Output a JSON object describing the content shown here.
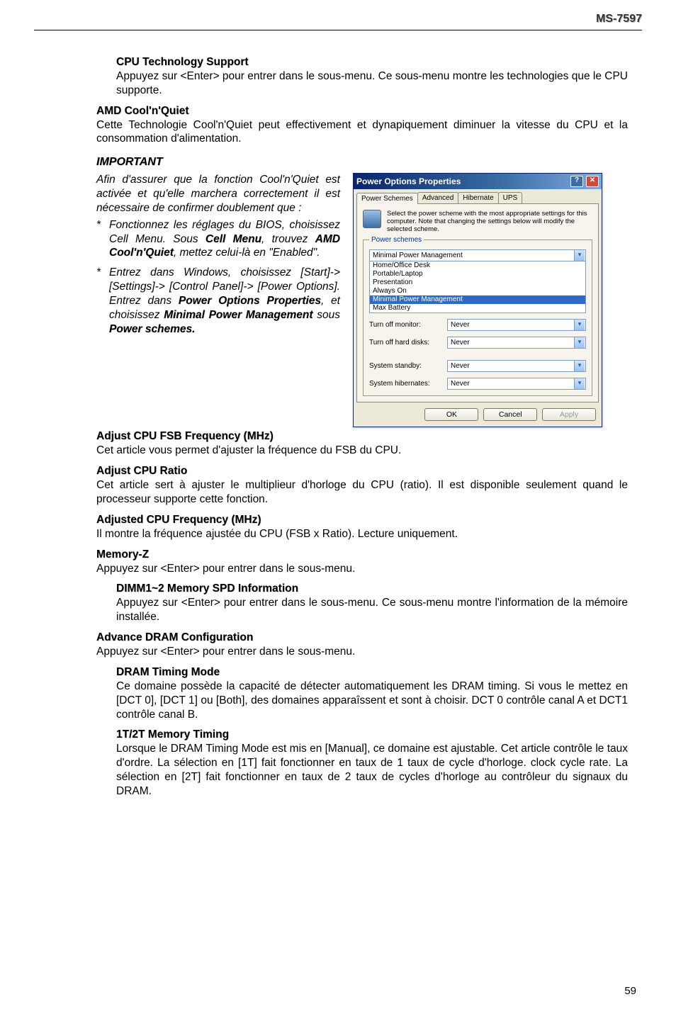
{
  "header": {
    "model": "MS-7597",
    "pageNumber": "59"
  },
  "sections": {
    "cpuTech": {
      "title": "CPU Technology Support",
      "body": "Appuyez sur <Enter> pour entrer dans le sous-menu. Ce sous-menu montre les technologies que le CPU supporte."
    },
    "coolnquiet": {
      "title": "AMD Cool'n'Quiet",
      "body": "Cette Technologie Cool'n'Quiet peut effectivement et dynapiquement diminuer la vitesse du CPU et la consommation d'alimentation."
    },
    "important": {
      "label": "IMPORTANT",
      "intro": "Afin d'assurer que la fonction Cool'n'Quiet est activée et qu'elle marchera correctement il est nécessaire de confirmer doublement que :",
      "bullet1_a": "Fonctionnez les réglages du BIOS, choisissez Cell Menu. Sous ",
      "bullet1_menu": "Cell Menu",
      "bullet1_b": ", trouvez ",
      "bullet1_cq": "AMD Cool'n'Quiet",
      "bullet1_c": ", mettez celui-là en  \"Enabled\".",
      "bullet2_a": "Entrez dans Windows, choisissez [Start]-> [Settings]-> [Control Panel]-> [Power Options]. Entrez dans ",
      "bullet2_pop": "Power Options Properties",
      "bullet2_b": ", et choisissez ",
      "bullet2_mpm": "Minimal Power Management",
      "bullet2_c": " sous ",
      "bullet2_ps": "Power schemes."
    },
    "adjFsb": {
      "title": "Adjust CPU FSB Frequency (MHz)",
      "body": "Cet article vous permet d'ajuster la fréquence du FSB du CPU."
    },
    "adjRatio": {
      "title": "Adjust CPU Ratio",
      "body": "Cet article sert à ajuster le multiplieur d'horloge du CPU (ratio). Il est disponible seulement quand le processeur supporte cette fonction."
    },
    "adjFreq": {
      "title": "Adjusted CPU Frequency (MHz)",
      "body": "Il montre la fréquence ajustée du CPU (FSB x Ratio). Lecture uniquement."
    },
    "memz": {
      "title": "Memory-Z",
      "body": "Appuyez sur <Enter> pour entrer dans le sous-menu."
    },
    "dimm": {
      "title": "DIMM1~2 Memory SPD Information",
      "body": "Appuyez sur <Enter> pour entrer dans le sous-menu. Ce sous-menu montre l'information de la mémoire installée."
    },
    "advDram": {
      "title": "Advance DRAM Configuration",
      "body": "Appuyez sur <Enter> pour entrer dans le sous-menu."
    },
    "dramTiming": {
      "title": "DRAM Timing Mode",
      "body": "Ce domaine possède la capacité de détecter automatiquement les DRAM timing. Si vous le mettez en [DCT 0], [DCT 1] ou [Both], des domaines apparaîssent et sont à choisir. DCT 0 contrôle canal A et DCT1 contrôle canal B."
    },
    "t1t2": {
      "title": "1T/2T Memory Timing",
      "body": "Lorsque le DRAM Timing Mode est mis en [Manual], ce domaine est ajustable. Cet article contrôle le taux d'ordre. La sélection en [1T] fait fonctionner en taux de 1 taux de cycle d'horloge. clock cycle rate. La sélection en [2T] fait fonctionner en taux de 2 taux de cycles d'horloge au contrôleur du signaux du DRAM."
    }
  },
  "dialog": {
    "title": "Power Options Properties",
    "tabs": [
      "Power Schemes",
      "Advanced",
      "Hibernate",
      "UPS"
    ],
    "activeTab": 0,
    "info": "Select the power scheme with the most appropriate settings for this computer. Note that changing the settings below will modify the selected scheme.",
    "legend": "Power schemes",
    "scheme": "Minimal Power Management",
    "listOptions": [
      "Home/Office Desk",
      "Portable/Laptop",
      "Presentation",
      "Always On",
      "Minimal Power Management",
      "Max Battery"
    ],
    "selectedIndex": 4,
    "rows": [
      {
        "label": "Turn off monitor:",
        "value": "Never"
      },
      {
        "label": "Turn off hard disks:",
        "value": "Never"
      },
      {
        "label": "System standby:",
        "value": "Never"
      },
      {
        "label": "System hibernates:",
        "value": "Never"
      }
    ],
    "buttons": {
      "ok": "OK",
      "cancel": "Cancel",
      "apply": "Apply"
    }
  }
}
